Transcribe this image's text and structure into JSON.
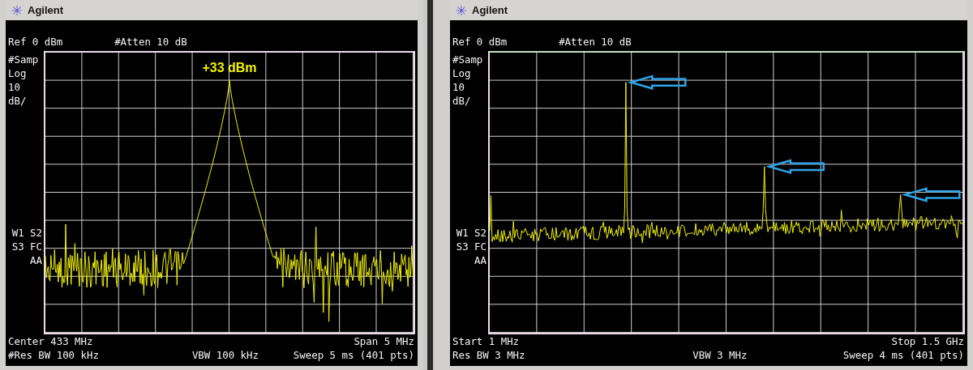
{
  "panels": [
    {
      "brand": "Agilent",
      "reference": "Ref 0 dBm",
      "attenuation": "#Atten 10 dB",
      "scale_labels": [
        "#Samp",
        "Log",
        "10",
        "dB/"
      ],
      "mode_labels": [
        "W1 S2",
        "S3 FC",
        "AA"
      ],
      "trace": {
        "kind": "single_peak",
        "marker": "+33 dBm"
      },
      "footer": [
        {
          "left": "Center 433 MHz",
          "right": "Span 5 MHz"
        },
        {
          "left": "#Res BW 100 kHz",
          "center": "VBW 100 kHz",
          "right": "Sweep 5 ms (401 pts)"
        }
      ]
    },
    {
      "brand": "Agilent",
      "reference": "Ref 0 dBm",
      "attenuation": "#Atten 10 dB",
      "scale_labels": [
        "#Samp",
        "Log",
        "10",
        "dB/"
      ],
      "mode_labels": [
        "W1 S2",
        "S3 FC",
        "AA"
      ],
      "trace": {
        "kind": "harmonics"
      },
      "footer": [
        {
          "left": "Start 1 MHz",
          "right": "Stop 1.5 GHz"
        },
        {
          "left": "Res BW 3 MHz",
          "center": "VBW 3 MHz",
          "right": "Sweep 4 ms (401 pts)"
        }
      ]
    }
  ]
}
